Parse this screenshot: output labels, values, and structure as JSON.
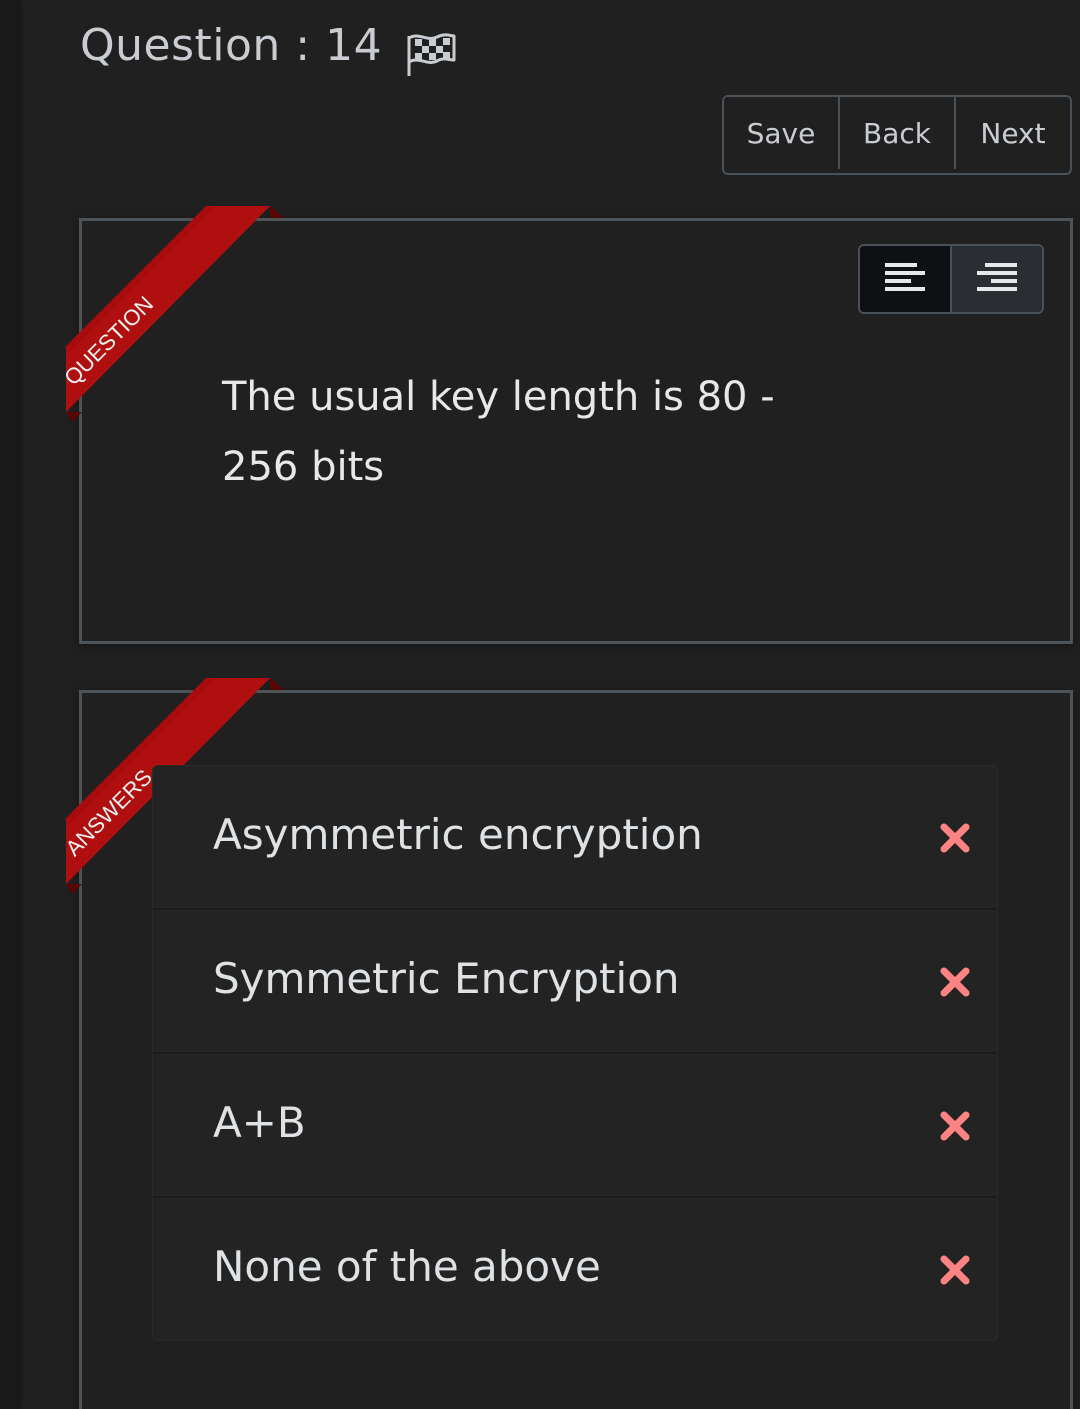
{
  "header": {
    "title": "Question : 14"
  },
  "toolbar": {
    "save_label": "Save",
    "back_label": "Back",
    "next_label": "Next"
  },
  "question_panel": {
    "ribbon_label": "QUESTION",
    "text": "The usual key length is 80 - 256 bits",
    "align_options": [
      "align-left-icon",
      "align-right-icon"
    ],
    "active_align": "align-left-icon"
  },
  "answers_panel": {
    "ribbon_label": "ANSWERS",
    "answers": [
      {
        "text": "Asymmetric encryption",
        "icon": "x-icon"
      },
      {
        "text": "Symmetric Encryption",
        "icon": "x-icon"
      },
      {
        "text": "A+B",
        "icon": "x-icon"
      },
      {
        "text": "None of the above",
        "icon": "x-icon"
      }
    ]
  },
  "colors": {
    "background": "#202020",
    "ribbon_red": "#a80c0c",
    "x_mark": "#ff8383",
    "text": "#e6e8ea"
  }
}
